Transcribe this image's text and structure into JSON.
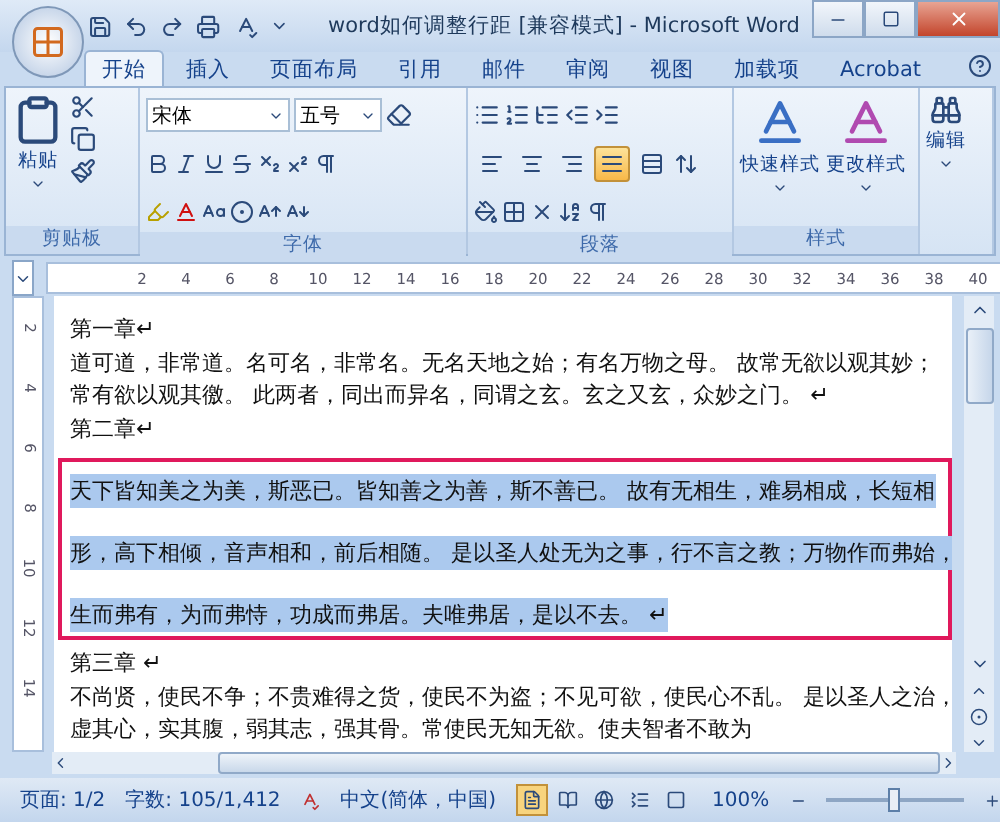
{
  "window": {
    "title": "word如何调整行距 [兼容模式] - Microsoft Word"
  },
  "tabs": [
    {
      "label": "开始",
      "selected": true
    },
    {
      "label": "插入",
      "selected": false
    },
    {
      "label": "页面布局",
      "selected": false
    },
    {
      "label": "引用",
      "selected": false
    },
    {
      "label": "邮件",
      "selected": false
    },
    {
      "label": "审阅",
      "selected": false
    },
    {
      "label": "视图",
      "selected": false
    },
    {
      "label": "加载项",
      "selected": false
    },
    {
      "label": "Acrobat",
      "selected": false
    }
  ],
  "ribbon": {
    "paste_label": "粘贴",
    "font_name": "宋体",
    "font_size": "五号",
    "alignment_buttons": [
      {
        "kind": "left",
        "selected": false
      },
      {
        "kind": "center",
        "selected": false
      },
      {
        "kind": "right",
        "selected": false
      },
      {
        "kind": "justify",
        "selected": true
      },
      {
        "kind": "distributed",
        "selected": false
      }
    ],
    "styles": [
      "快速样式",
      "更改样式"
    ],
    "edit_label": "编辑",
    "groups": [
      "剪贴板",
      "字体",
      "段落",
      "样式"
    ]
  },
  "ruler": {
    "ticks": [
      "2",
      "4",
      "6",
      "8",
      "10",
      "12",
      "14",
      "16",
      "18",
      "20",
      "22",
      "24",
      "26",
      "28",
      "30",
      "32",
      "34",
      "36",
      "38",
      "40"
    ],
    "vertical_ticks": [
      "2",
      "4",
      "6",
      "8",
      "10",
      "12",
      "14"
    ]
  },
  "document": {
    "paragraphs": [
      {
        "selected": false,
        "lines": [
          "第一章↵"
        ]
      },
      {
        "selected": false,
        "lines": [
          "道可道，非常道。名可名，非常名。无名天地之始；有名万物之母。 故常无欲以观其妙；",
          "常有欲以观其徼。 此两者，同出而异名，同谓之玄。玄之又玄，众妙之门。 ↵"
        ]
      },
      {
        "selected": false,
        "lines": [
          "第二章↵"
        ]
      },
      {
        "selected": true,
        "lines": [
          "天下皆知美之为美，斯恶已。皆知善之为善，斯不善已。 故有无相生，难易相成，长短相",
          "形，高下相倾，音声相和，前后相随。 是以圣人处无为之事，行不言之教；万物作而弗始，",
          "生而弗有，为而弗恃，功成而弗居。夫唯弗居，是以不去。 ↵"
        ]
      },
      {
        "selected": false,
        "lines": [
          "第三章 ↵"
        ]
      },
      {
        "selected": false,
        "lines": [
          "不尚贤，使民不争；不贵难得之货，使民不为盗；不见可欲，使民心不乱。 是以圣人之治，",
          "虚其心，实其腹，弱其志，强其骨。常使民无知无欲。使夫智者不敢为"
        ]
      }
    ]
  },
  "status_bar": {
    "page": "页面: 1/2",
    "words": "字数: 105/1,412",
    "language": "中文(简体，中国)",
    "views": [
      {
        "kind": "print",
        "selected": true
      },
      {
        "kind": "reading",
        "selected": false
      },
      {
        "kind": "web",
        "selected": false
      },
      {
        "kind": "outline",
        "selected": false
      },
      {
        "kind": "draft",
        "selected": false
      }
    ],
    "zoom": "100%",
    "zoom_level": {
      "level": 0.5
    }
  }
}
